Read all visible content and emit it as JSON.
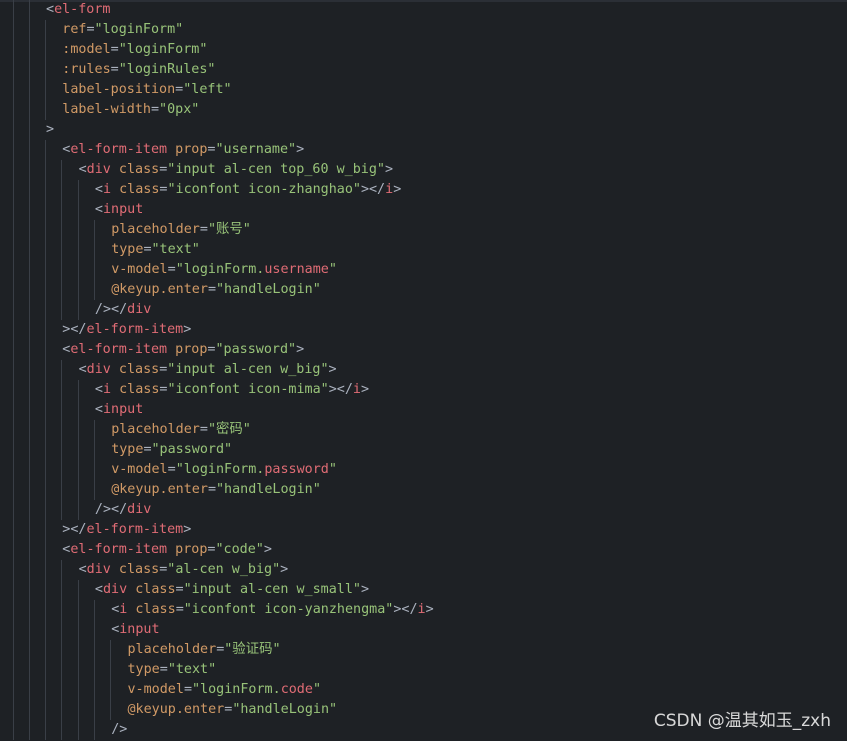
{
  "editor": {
    "language": "vue-template",
    "lines": [
      {
        "indent": 0,
        "tokens": [
          {
            "t": "<",
            "k": "pun"
          },
          {
            "t": "el-form",
            "k": "tag"
          }
        ]
      },
      {
        "indent": 1,
        "tokens": [
          {
            "t": "ref",
            "k": "attr"
          },
          {
            "t": "=",
            "k": "pun"
          },
          {
            "t": "\"loginForm\"",
            "k": "str"
          }
        ]
      },
      {
        "indent": 1,
        "tokens": [
          {
            "t": ":model",
            "k": "attr"
          },
          {
            "t": "=",
            "k": "pun"
          },
          {
            "t": "\"loginForm\"",
            "k": "str"
          }
        ]
      },
      {
        "indent": 1,
        "tokens": [
          {
            "t": ":rules",
            "k": "attr"
          },
          {
            "t": "=",
            "k": "pun"
          },
          {
            "t": "\"loginRules\"",
            "k": "str"
          }
        ]
      },
      {
        "indent": 1,
        "tokens": [
          {
            "t": "label-position",
            "k": "attr"
          },
          {
            "t": "=",
            "k": "pun"
          },
          {
            "t": "\"left\"",
            "k": "str"
          }
        ]
      },
      {
        "indent": 1,
        "tokens": [
          {
            "t": "label-width",
            "k": "attr"
          },
          {
            "t": "=",
            "k": "pun"
          },
          {
            "t": "\"0px\"",
            "k": "str"
          }
        ]
      },
      {
        "indent": 0,
        "tokens": [
          {
            "t": ">",
            "k": "pun"
          }
        ]
      },
      {
        "indent": 1,
        "tokens": [
          {
            "t": "<",
            "k": "pun"
          },
          {
            "t": "el-form-item",
            "k": "tag"
          },
          {
            "t": " ",
            "k": "pun"
          },
          {
            "t": "prop",
            "k": "attr"
          },
          {
            "t": "=",
            "k": "pun"
          },
          {
            "t": "\"username\"",
            "k": "str"
          },
          {
            "t": ">",
            "k": "pun"
          }
        ]
      },
      {
        "indent": 2,
        "tokens": [
          {
            "t": "<",
            "k": "pun"
          },
          {
            "t": "div",
            "k": "tag"
          },
          {
            "t": " ",
            "k": "pun"
          },
          {
            "t": "class",
            "k": "attr"
          },
          {
            "t": "=",
            "k": "pun"
          },
          {
            "t": "\"input al-cen top_60 w_big\"",
            "k": "str"
          },
          {
            "t": ">",
            "k": "pun"
          }
        ]
      },
      {
        "indent": 3,
        "tokens": [
          {
            "t": "<",
            "k": "pun"
          },
          {
            "t": "i",
            "k": "tag"
          },
          {
            "t": " ",
            "k": "pun"
          },
          {
            "t": "class",
            "k": "attr"
          },
          {
            "t": "=",
            "k": "pun"
          },
          {
            "t": "\"iconfont icon-zhanghao\"",
            "k": "str"
          },
          {
            "t": "></",
            "k": "pun"
          },
          {
            "t": "i",
            "k": "tag"
          },
          {
            "t": ">",
            "k": "pun"
          }
        ]
      },
      {
        "indent": 3,
        "tokens": [
          {
            "t": "<",
            "k": "pun"
          },
          {
            "t": "input",
            "k": "tag"
          }
        ]
      },
      {
        "indent": 4,
        "tokens": [
          {
            "t": "placeholder",
            "k": "attr"
          },
          {
            "t": "=",
            "k": "pun"
          },
          {
            "t": "\"账号\"",
            "k": "str"
          }
        ]
      },
      {
        "indent": 4,
        "tokens": [
          {
            "t": "type",
            "k": "attr"
          },
          {
            "t": "=",
            "k": "pun"
          },
          {
            "t": "\"text\"",
            "k": "str"
          }
        ]
      },
      {
        "indent": 4,
        "tokens": [
          {
            "t": "v-model",
            "k": "attr"
          },
          {
            "t": "=",
            "k": "pun"
          },
          {
            "t": "\"loginForm.",
            "k": "str"
          },
          {
            "t": "username",
            "k": "var"
          },
          {
            "t": "\"",
            "k": "str"
          }
        ]
      },
      {
        "indent": 4,
        "tokens": [
          {
            "t": "@keyup.enter",
            "k": "attr"
          },
          {
            "t": "=",
            "k": "pun"
          },
          {
            "t": "\"handleLogin\"",
            "k": "str"
          }
        ]
      },
      {
        "indent": 3,
        "tokens": [
          {
            "t": "/></",
            "k": "pun"
          },
          {
            "t": "div",
            "k": "tag"
          }
        ]
      },
      {
        "indent": 1,
        "tokens": [
          {
            "t": "></",
            "k": "pun"
          },
          {
            "t": "el-form-item",
            "k": "tag"
          },
          {
            "t": ">",
            "k": "pun"
          }
        ]
      },
      {
        "indent": 1,
        "tokens": [
          {
            "t": "<",
            "k": "pun"
          },
          {
            "t": "el-form-item",
            "k": "tag"
          },
          {
            "t": " ",
            "k": "pun"
          },
          {
            "t": "prop",
            "k": "attr"
          },
          {
            "t": "=",
            "k": "pun"
          },
          {
            "t": "\"password\"",
            "k": "str"
          },
          {
            "t": ">",
            "k": "pun"
          }
        ]
      },
      {
        "indent": 2,
        "tokens": [
          {
            "t": "<",
            "k": "pun"
          },
          {
            "t": "div",
            "k": "tag"
          },
          {
            "t": " ",
            "k": "pun"
          },
          {
            "t": "class",
            "k": "attr"
          },
          {
            "t": "=",
            "k": "pun"
          },
          {
            "t": "\"input al-cen w_big\"",
            "k": "str"
          },
          {
            "t": ">",
            "k": "pun"
          }
        ]
      },
      {
        "indent": 3,
        "tokens": [
          {
            "t": "<",
            "k": "pun"
          },
          {
            "t": "i",
            "k": "tag"
          },
          {
            "t": " ",
            "k": "pun"
          },
          {
            "t": "class",
            "k": "attr"
          },
          {
            "t": "=",
            "k": "pun"
          },
          {
            "t": "\"iconfont icon-mima\"",
            "k": "str"
          },
          {
            "t": "></",
            "k": "pun"
          },
          {
            "t": "i",
            "k": "tag"
          },
          {
            "t": ">",
            "k": "pun"
          }
        ]
      },
      {
        "indent": 3,
        "tokens": [
          {
            "t": "<",
            "k": "pun"
          },
          {
            "t": "input",
            "k": "tag"
          }
        ]
      },
      {
        "indent": 4,
        "tokens": [
          {
            "t": "placeholder",
            "k": "attr"
          },
          {
            "t": "=",
            "k": "pun"
          },
          {
            "t": "\"密码\"",
            "k": "str"
          }
        ]
      },
      {
        "indent": 4,
        "tokens": [
          {
            "t": "type",
            "k": "attr"
          },
          {
            "t": "=",
            "k": "pun"
          },
          {
            "t": "\"password\"",
            "k": "str"
          }
        ]
      },
      {
        "indent": 4,
        "tokens": [
          {
            "t": "v-model",
            "k": "attr"
          },
          {
            "t": "=",
            "k": "pun"
          },
          {
            "t": "\"loginForm.",
            "k": "str"
          },
          {
            "t": "password",
            "k": "var"
          },
          {
            "t": "\"",
            "k": "str"
          }
        ]
      },
      {
        "indent": 4,
        "tokens": [
          {
            "t": "@keyup.enter",
            "k": "attr"
          },
          {
            "t": "=",
            "k": "pun"
          },
          {
            "t": "\"handleLogin\"",
            "k": "str"
          }
        ]
      },
      {
        "indent": 3,
        "tokens": [
          {
            "t": "/></",
            "k": "pun"
          },
          {
            "t": "div",
            "k": "tag"
          }
        ]
      },
      {
        "indent": 1,
        "tokens": [
          {
            "t": "></",
            "k": "pun"
          },
          {
            "t": "el-form-item",
            "k": "tag"
          },
          {
            "t": ">",
            "k": "pun"
          }
        ]
      },
      {
        "indent": 1,
        "tokens": [
          {
            "t": "<",
            "k": "pun"
          },
          {
            "t": "el-form-item",
            "k": "tag"
          },
          {
            "t": " ",
            "k": "pun"
          },
          {
            "t": "prop",
            "k": "attr"
          },
          {
            "t": "=",
            "k": "pun"
          },
          {
            "t": "\"code\"",
            "k": "str"
          },
          {
            "t": ">",
            "k": "pun"
          }
        ]
      },
      {
        "indent": 2,
        "tokens": [
          {
            "t": "<",
            "k": "pun"
          },
          {
            "t": "div",
            "k": "tag"
          },
          {
            "t": " ",
            "k": "pun"
          },
          {
            "t": "class",
            "k": "attr"
          },
          {
            "t": "=",
            "k": "pun"
          },
          {
            "t": "\"al-cen w_big\"",
            "k": "str"
          },
          {
            "t": ">",
            "k": "pun"
          }
        ]
      },
      {
        "indent": 3,
        "tokens": [
          {
            "t": "<",
            "k": "pun"
          },
          {
            "t": "div",
            "k": "tag"
          },
          {
            "t": " ",
            "k": "pun"
          },
          {
            "t": "class",
            "k": "attr"
          },
          {
            "t": "=",
            "k": "pun"
          },
          {
            "t": "\"input al-cen w_small\"",
            "k": "str"
          },
          {
            "t": ">",
            "k": "pun"
          }
        ]
      },
      {
        "indent": 4,
        "tokens": [
          {
            "t": "<",
            "k": "pun"
          },
          {
            "t": "i",
            "k": "tag"
          },
          {
            "t": " ",
            "k": "pun"
          },
          {
            "t": "class",
            "k": "attr"
          },
          {
            "t": "=",
            "k": "pun"
          },
          {
            "t": "\"iconfont icon-yanzhengma\"",
            "k": "str"
          },
          {
            "t": "></",
            "k": "pun"
          },
          {
            "t": "i",
            "k": "tag"
          },
          {
            "t": ">",
            "k": "pun"
          }
        ]
      },
      {
        "indent": 4,
        "tokens": [
          {
            "t": "<",
            "k": "pun"
          },
          {
            "t": "input",
            "k": "tag"
          }
        ]
      },
      {
        "indent": 5,
        "tokens": [
          {
            "t": "placeholder",
            "k": "attr"
          },
          {
            "t": "=",
            "k": "pun"
          },
          {
            "t": "\"验证码\"",
            "k": "str"
          }
        ]
      },
      {
        "indent": 5,
        "tokens": [
          {
            "t": "type",
            "k": "attr"
          },
          {
            "t": "=",
            "k": "pun"
          },
          {
            "t": "\"text\"",
            "k": "str"
          }
        ]
      },
      {
        "indent": 5,
        "tokens": [
          {
            "t": "v-model",
            "k": "attr"
          },
          {
            "t": "=",
            "k": "pun"
          },
          {
            "t": "\"loginForm.",
            "k": "str"
          },
          {
            "t": "code",
            "k": "var"
          },
          {
            "t": "\"",
            "k": "str"
          }
        ]
      },
      {
        "indent": 5,
        "tokens": [
          {
            "t": "@keyup.enter",
            "k": "attr"
          },
          {
            "t": "=",
            "k": "pun"
          },
          {
            "t": "\"handleLogin\"",
            "k": "str"
          }
        ]
      },
      {
        "indent": 4,
        "tokens": [
          {
            "t": "/>",
            "k": "pun"
          }
        ]
      }
    ]
  },
  "colors": {
    "background": "#1e2125",
    "tag": "#e06c75",
    "attribute": "#d19a66",
    "string": "#98c379",
    "punctuation": "#abb2bf",
    "indent_guide": "#3a3f47"
  },
  "watermark": {
    "text": "CSDN @温其如玉_zxh"
  }
}
